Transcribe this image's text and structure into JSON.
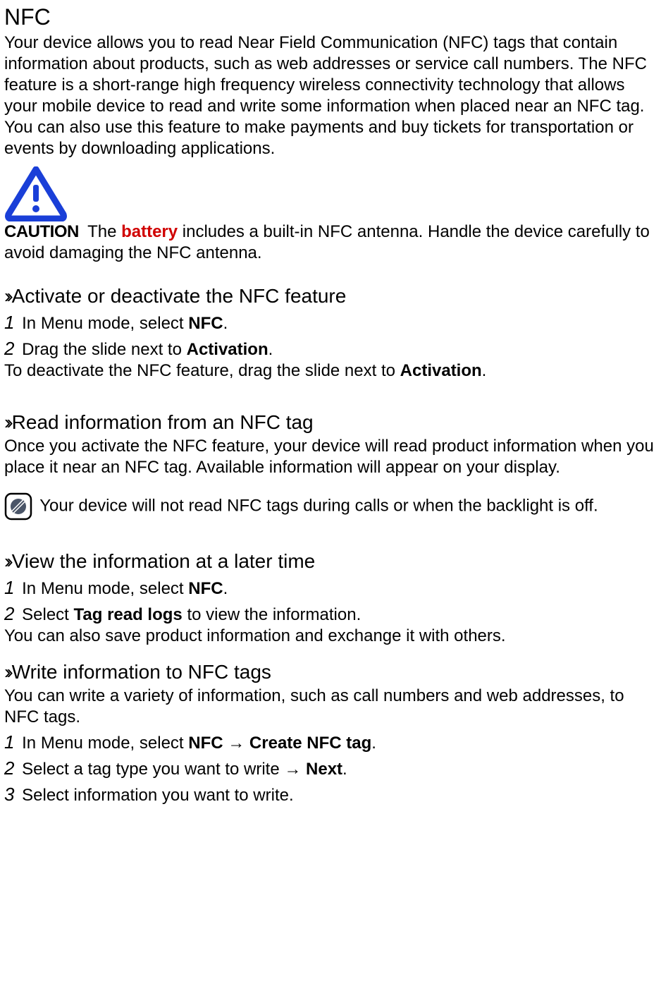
{
  "title": "NFC",
  "intro": "Your device allows you to read Near Field Communication (NFC) tags that contain information about products, such as web addresses or service call numbers. The NFC feature is a short-range high frequency wireless connectivity technology that allows your mobile device to read and write some information when placed near an NFC tag. You can also use this feature to make payments and buy tickets for transportation or events by downloading applications.",
  "caution": {
    "label": "CAUTION",
    "pre": " The ",
    "highlight": "battery",
    "post": " includes a built-in NFC antenna. Handle the device carefully to avoid damaging the NFC antenna."
  },
  "sections": {
    "activate": {
      "heading": "Activate or deactivate the NFC feature",
      "step1_num": "1",
      "step1_a": " In Menu mode, select ",
      "step1_b": "NFC",
      "step1_c": ".",
      "step2_num": "2",
      "step2_a": " Drag the slide next to ",
      "step2_b": "Activation",
      "step2_c": ".",
      "deact_a": "To deactivate the NFC feature, drag the slide next to ",
      "deact_b": "Activation",
      "deact_c": "."
    },
    "read": {
      "heading": "Read information from an NFC tag",
      "body": "Once you activate the NFC feature, your device will read product information when you place it near an NFC tag. Available information will appear on your display.",
      "note": " Your device will not read NFC tags during calls or when the backlight is off."
    },
    "view": {
      "heading": "View the information at a later time",
      "step1_num": "1",
      "step1_a": " In Menu mode, select ",
      "step1_b": "NFC",
      "step1_c": ".",
      "step2_num": "2",
      "step2_a": " Select ",
      "step2_b": "Tag read logs",
      "step2_c": " to view the information.",
      "footer": "You can also save product information and exchange it with others."
    },
    "write": {
      "heading": "Write information to NFC tags",
      "body": "You can write a variety of information, such as call numbers and web addresses, to NFC tags.",
      "step1_num": "1",
      "step1_a": " In Menu mode, select ",
      "step1_b": "NFC → Create NFC tag",
      "step1_c": ".",
      "step2_num": "2",
      "step2_a": " Select a tag type you want to write → ",
      "step2_b": "Next",
      "step2_c": ".",
      "step3_num": "3",
      "step3_a": " Select information you want to write."
    }
  }
}
